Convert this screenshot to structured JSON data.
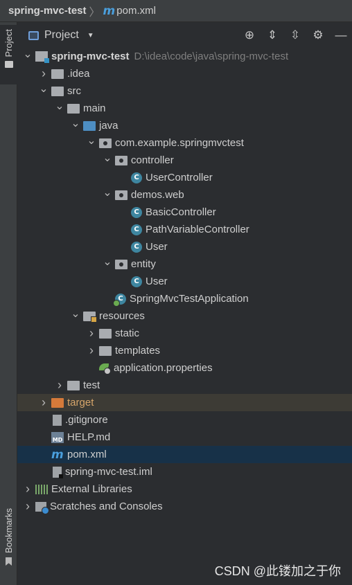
{
  "breadcrumb": {
    "project": "spring-mvc-test",
    "separator": "〉",
    "file": "pom.xml",
    "file_icon": "m"
  },
  "leftstrip": {
    "project_tab": "Project",
    "bookmarks_tab": "Bookmarks"
  },
  "panel": {
    "title": "Project",
    "tools": [
      "locate-icon",
      "expand-all-icon",
      "collapse-all-icon",
      "gear-icon",
      "minimize-icon"
    ]
  },
  "tree": [
    {
      "label": "spring-mvc-test",
      "path": "D:\\idea\\code\\java\\spring-mvc-test",
      "icon": "module",
      "depth": 0,
      "arrow": "open"
    },
    {
      "label": ".idea",
      "icon": "folder",
      "depth": 1,
      "arrow": "closed"
    },
    {
      "label": "src",
      "icon": "folder",
      "depth": 1,
      "arrow": "open"
    },
    {
      "label": "main",
      "icon": "folder",
      "depth": 2,
      "arrow": "open"
    },
    {
      "label": "java",
      "icon": "folder-blue",
      "depth": 3,
      "arrow": "open"
    },
    {
      "label": "com.example.springmvctest",
      "icon": "package",
      "depth": 4,
      "arrow": "open"
    },
    {
      "label": "controller",
      "icon": "package",
      "depth": 5,
      "arrow": "open"
    },
    {
      "label": "UserController",
      "icon": "class",
      "depth": 6,
      "arrow": "none"
    },
    {
      "label": "demos.web",
      "icon": "package",
      "depth": 5,
      "arrow": "open"
    },
    {
      "label": "BasicController",
      "icon": "class",
      "depth": 6,
      "arrow": "none"
    },
    {
      "label": "PathVariableController",
      "icon": "class",
      "depth": 6,
      "arrow": "none"
    },
    {
      "label": "User",
      "icon": "class",
      "depth": 6,
      "arrow": "none"
    },
    {
      "label": "entity",
      "icon": "package",
      "depth": 5,
      "arrow": "open"
    },
    {
      "label": "User",
      "icon": "class",
      "depth": 6,
      "arrow": "none"
    },
    {
      "label": "SpringMvcTestApplication",
      "icon": "spring-class",
      "depth": 5,
      "arrow": "none"
    },
    {
      "label": "resources",
      "icon": "folder-resources",
      "depth": 3,
      "arrow": "open"
    },
    {
      "label": "static",
      "icon": "folder",
      "depth": 4,
      "arrow": "closed"
    },
    {
      "label": "templates",
      "icon": "folder",
      "depth": 4,
      "arrow": "closed"
    },
    {
      "label": "application.properties",
      "icon": "properties",
      "depth": 4,
      "arrow": "none"
    },
    {
      "label": "test",
      "icon": "folder",
      "depth": 2,
      "arrow": "closed"
    },
    {
      "label": "target",
      "icon": "folder-orange",
      "depth": 1,
      "arrow": "closed",
      "state": "excluded"
    },
    {
      "label": ".gitignore",
      "icon": "file",
      "depth": 1,
      "arrow": "none"
    },
    {
      "label": "HELP.md",
      "icon": "markdown",
      "depth": 1,
      "arrow": "none"
    },
    {
      "label": "pom.xml",
      "icon": "maven",
      "depth": 1,
      "arrow": "none",
      "state": "selected"
    },
    {
      "label": "spring-mvc-test.iml",
      "icon": "iml",
      "depth": 1,
      "arrow": "none"
    },
    {
      "label": "External Libraries",
      "icon": "libraries",
      "depth": 0,
      "arrow": "closed"
    },
    {
      "label": "Scratches and Consoles",
      "icon": "scratches",
      "depth": 0,
      "arrow": "closed"
    }
  ],
  "watermark": "CSDN @此镂加之于你"
}
